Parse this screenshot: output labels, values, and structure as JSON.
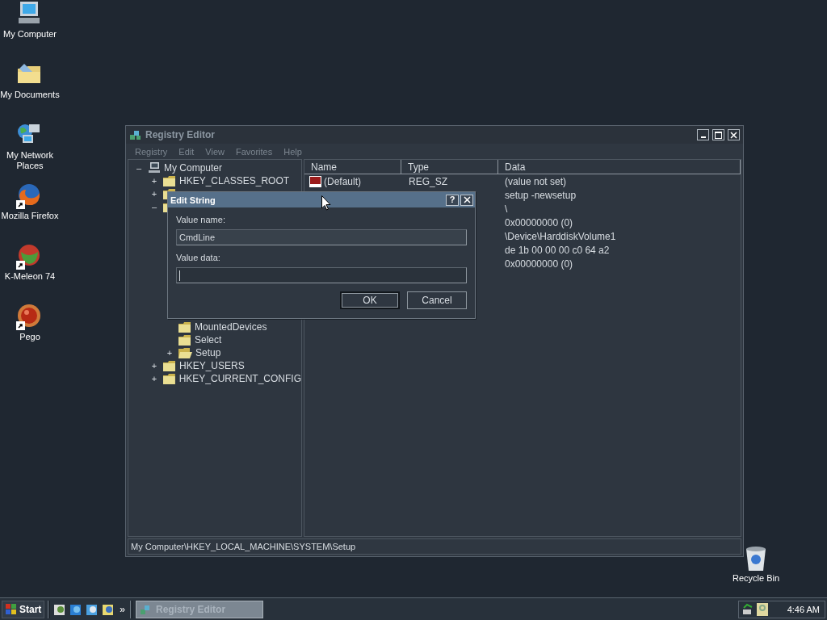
{
  "desktop_icons": [
    {
      "label": "My Computer",
      "kind": "computer",
      "shortcut": false
    },
    {
      "label": "My Documents",
      "kind": "documents",
      "shortcut": false
    },
    {
      "label": "My Network Places",
      "kind": "network",
      "shortcut": false
    },
    {
      "label": "Mozilla Firefox",
      "kind": "firefox",
      "shortcut": true
    },
    {
      "label": "K-Meleon 74",
      "kind": "kmeleon",
      "shortcut": true
    },
    {
      "label": "Pego",
      "kind": "pego",
      "shortcut": true
    }
  ],
  "recycle_bin": {
    "label": "Recycle Bin"
  },
  "registry_editor": {
    "title": "Registry Editor",
    "menu": [
      {
        "label": "Registry",
        "disabled": true
      },
      {
        "label": "Edit",
        "disabled": true
      },
      {
        "label": "View",
        "disabled": true
      },
      {
        "label": "Favorites",
        "disabled": true
      },
      {
        "label": "Help",
        "disabled": true
      }
    ],
    "tree": [
      {
        "label": "My Computer",
        "kind": "computer",
        "expander": "–",
        "children": [
          {
            "label": "HKEY_CLASSES_ROOT",
            "kind": "folder",
            "expander": "+"
          },
          {
            "kind": "folder",
            "expander": "+"
          },
          {
            "kind": "folder",
            "expander": "–",
            "children": [
              {
                "label": "MountedDevices",
                "kind": "folder"
              },
              {
                "label": "Select",
                "kind": "folder"
              },
              {
                "label": "Setup",
                "kind": "folder-open",
                "expander": "+"
              }
            ]
          },
          {
            "label": "HKEY_USERS",
            "kind": "folder",
            "expander": "+"
          },
          {
            "label": "HKEY_CURRENT_CONFIG",
            "kind": "folder",
            "expander": "+"
          }
        ]
      }
    ],
    "list": {
      "columns": [
        "Name",
        "Type",
        "Data"
      ],
      "rows": [
        {
          "name": "(Default)",
          "type": "REG_SZ",
          "data": "(value not set)"
        },
        {
          "data": "setup -newsetup"
        },
        {
          "data": "\\"
        },
        {
          "data": "0x00000000 (0)"
        },
        {
          "data": "\\Device\\HarddiskVolume1"
        },
        {
          "data": "de 1b 00 00 00 c0 64 a2"
        },
        {
          "data": "0x00000000 (0)"
        }
      ]
    },
    "status_bar": "My Computer\\HKEY_LOCAL_MACHINE\\SYSTEM\\Setup"
  },
  "dialog": {
    "title": "Edit String",
    "help": "?",
    "fields": [
      {
        "label": "Value name:",
        "value": "CmdLine",
        "focused": false
      },
      {
        "label": "Value data:",
        "focused": true
      }
    ],
    "buttons": [
      {
        "label": "OK",
        "default": true
      },
      {
        "label": "Cancel",
        "default": false
      }
    ]
  },
  "taskbar": {
    "start": "Start",
    "more": "»",
    "tasks": [
      {
        "label": "Registry Editor",
        "selected": true
      }
    ],
    "clock": "4:46 AM"
  }
}
